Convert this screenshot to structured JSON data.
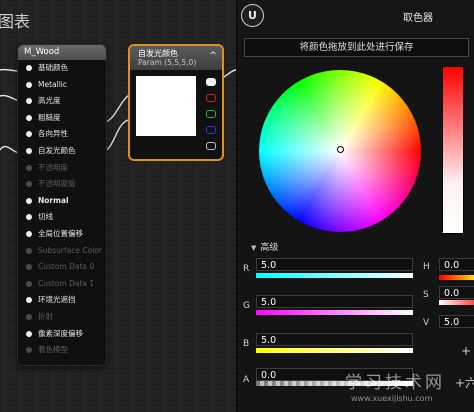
{
  "graph": {
    "title_fragment": "图表",
    "material_node": {
      "title": "M_Wood",
      "pins": [
        {
          "label": "基础颜色",
          "enabled": true,
          "bold": false
        },
        {
          "label": "Metallic",
          "enabled": true,
          "bold": false
        },
        {
          "label": "高光度",
          "enabled": true,
          "bold": false
        },
        {
          "label": "粗糙度",
          "enabled": true,
          "bold": false
        },
        {
          "label": "各向异性",
          "enabled": true,
          "bold": false
        },
        {
          "label": "自发光颜色",
          "enabled": true,
          "bold": false
        },
        {
          "label": "不透明度",
          "enabled": false,
          "bold": false
        },
        {
          "label": "不透明蒙版",
          "enabled": false,
          "bold": false
        },
        {
          "label": "Normal",
          "enabled": true,
          "bold": true
        },
        {
          "label": "切线",
          "enabled": true,
          "bold": false
        },
        {
          "label": "全局位置偏移",
          "enabled": true,
          "bold": false
        },
        {
          "label": "Subsurface Color",
          "enabled": false,
          "bold": false
        },
        {
          "label": "Custom Data 0",
          "enabled": false,
          "bold": false
        },
        {
          "label": "Custom Data 1",
          "enabled": false,
          "bold": false
        },
        {
          "label": "环境光遮挡",
          "enabled": true,
          "bold": false
        },
        {
          "label": "折射",
          "enabled": false,
          "bold": false
        },
        {
          "label": "像素深度偏移",
          "enabled": true,
          "bold": false
        },
        {
          "label": "着色模型",
          "enabled": false,
          "bold": false
        }
      ]
    },
    "param_node": {
      "title": "自发光颜色",
      "subtitle": "Param (5,5,5,0)",
      "collapse_icon": "chevron-up-icon",
      "swatch_color": "#ffffff",
      "output_pin_colors": [
        "#f0f0f0",
        "#e02020",
        "#20c020",
        "#2040e0",
        "#c0c0c0"
      ]
    }
  },
  "picker": {
    "window_title": "取色器",
    "logo_icon": "unreal-logo-icon",
    "save_hint": "将颜色拖放到此处进行保存",
    "advanced_label": "高级",
    "channels": [
      {
        "label": "R",
        "value": "5.0"
      },
      {
        "label": "G",
        "value": "5.0"
      },
      {
        "label": "B",
        "value": "5.0"
      },
      {
        "label": "A",
        "value": "0.0"
      }
    ],
    "hsv": [
      {
        "label": "H",
        "value": "0.0"
      },
      {
        "label": "S",
        "value": "0.0"
      },
      {
        "label": "V",
        "value": "5.0"
      }
    ],
    "plus_labels": [
      "+",
      "+六"
    ]
  },
  "watermark": {
    "text": "学习技术网",
    "url": "www.xuexijishu.com"
  }
}
